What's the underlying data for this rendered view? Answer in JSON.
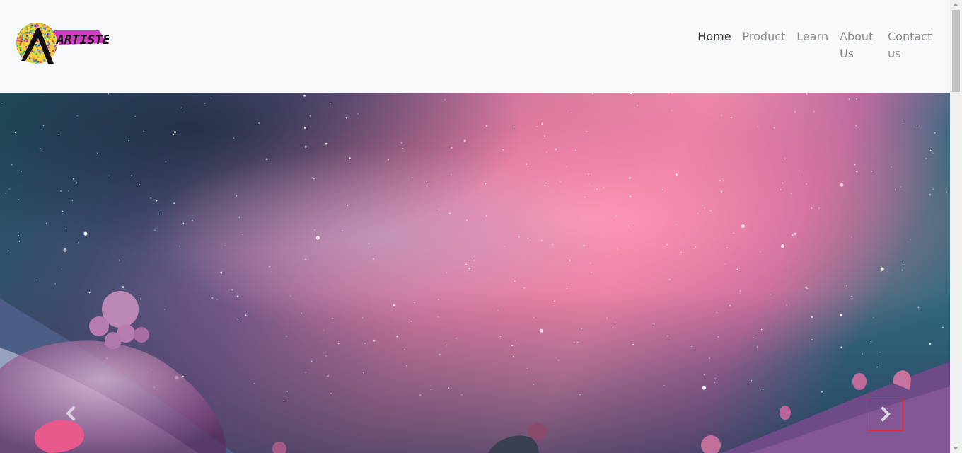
{
  "brand": {
    "logo_text": "ARTISTE",
    "logo_icon": "artiste-logo-icon"
  },
  "nav": {
    "items": [
      {
        "label": "Home",
        "active": true
      },
      {
        "label": "Product",
        "active": false
      },
      {
        "label": "Learn",
        "active": false
      },
      {
        "label": "About Us",
        "active": false
      },
      {
        "label": "Contact us",
        "active": false
      }
    ]
  },
  "carousel": {
    "prev_icon": "chevron-left-icon",
    "next_icon": "chevron-right-icon",
    "image_subject": "galaxy-nebula-fantasy-landscape"
  },
  "colors": {
    "navbar_bg": "#f8f9fa",
    "nav_active": "#333333",
    "nav_inactive": "#8a8a8a",
    "next_focus_border": "#e02a3a"
  }
}
